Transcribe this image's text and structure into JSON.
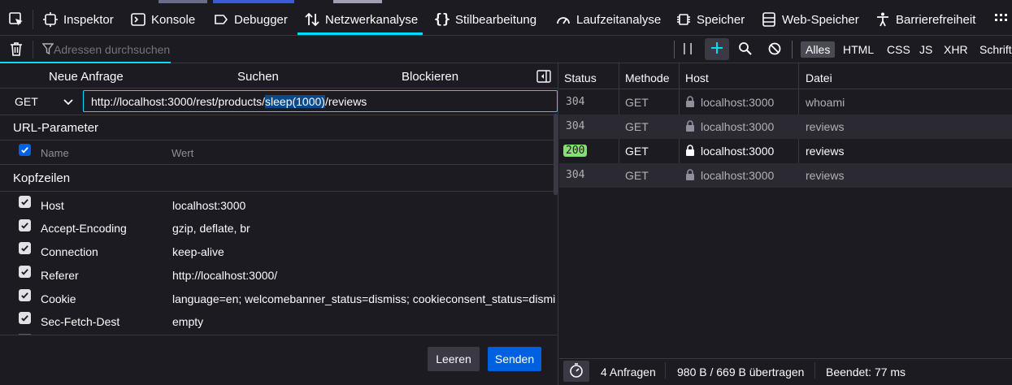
{
  "colors": {
    "background": "#1c1b22",
    "accent": "#00ddff",
    "primary_button": "#0061e0",
    "status_ok": "#86de74"
  },
  "tabs": [
    {
      "label": "Inspektor",
      "icon": "inspector-icon"
    },
    {
      "label": "Konsole",
      "icon": "console-icon"
    },
    {
      "label": "Debugger",
      "icon": "debugger-icon"
    },
    {
      "label": "Netzwerkanalyse",
      "icon": "network-icon",
      "active": true
    },
    {
      "label": "Stilbearbeitung",
      "icon": "style-editor-icon"
    },
    {
      "label": "Laufzeitanalyse",
      "icon": "performance-icon"
    },
    {
      "label": "Speicher",
      "icon": "memory-icon"
    },
    {
      "label": "Web-Speicher",
      "icon": "storage-icon"
    },
    {
      "label": "Barrierefreiheit",
      "icon": "accessibility-icon"
    }
  ],
  "toolbar": {
    "filter_placeholder": "Adressen durchsuchen",
    "filters": [
      "Alles",
      "HTML",
      "CSS",
      "JS",
      "XHR",
      "Schrifte"
    ]
  },
  "left": {
    "subtabs": [
      "Neue Anfrage",
      "Suchen",
      "Blockieren"
    ],
    "method": "GET",
    "url_prefix": "http://localhost:3000/rest/products/",
    "url_selected": "sleep(1000)",
    "url_suffix": "/reviews",
    "url_params_title": "URL-Parameter",
    "param_name_placeholder": "Name",
    "param_value_placeholder": "Wert",
    "headers_title": "Kopfzeilen",
    "headers": [
      {
        "name": "Host",
        "value": "localhost:3000"
      },
      {
        "name": "Accept-Encoding",
        "value": "gzip, deflate, br"
      },
      {
        "name": "Connection",
        "value": "keep-alive"
      },
      {
        "name": "Referer",
        "value": "http://localhost:3000/"
      },
      {
        "name": "Cookie",
        "value": "language=en; welcomebanner_status=dismiss; cookieconsent_status=dismi..."
      },
      {
        "name": "Sec-Fetch-Dest",
        "value": "empty"
      }
    ],
    "clear_label": "Leeren",
    "send_label": "Senden"
  },
  "right": {
    "columns": [
      "Status",
      "Methode",
      "Host",
      "Datei"
    ],
    "requests": [
      {
        "status": "304",
        "method": "GET",
        "host": "localhost:3000",
        "file": "whoami"
      },
      {
        "status": "304",
        "method": "GET",
        "host": "localhost:3000",
        "file": "reviews"
      },
      {
        "status": "200",
        "method": "GET",
        "host": "localhost:3000",
        "file": "reviews"
      },
      {
        "status": "304",
        "method": "GET",
        "host": "localhost:3000",
        "file": "reviews"
      }
    ],
    "summary": {
      "requests": "4 Anfragen",
      "transferred": "980 B / 669 B übertragen",
      "finished": "Beendet: 77 ms"
    }
  }
}
